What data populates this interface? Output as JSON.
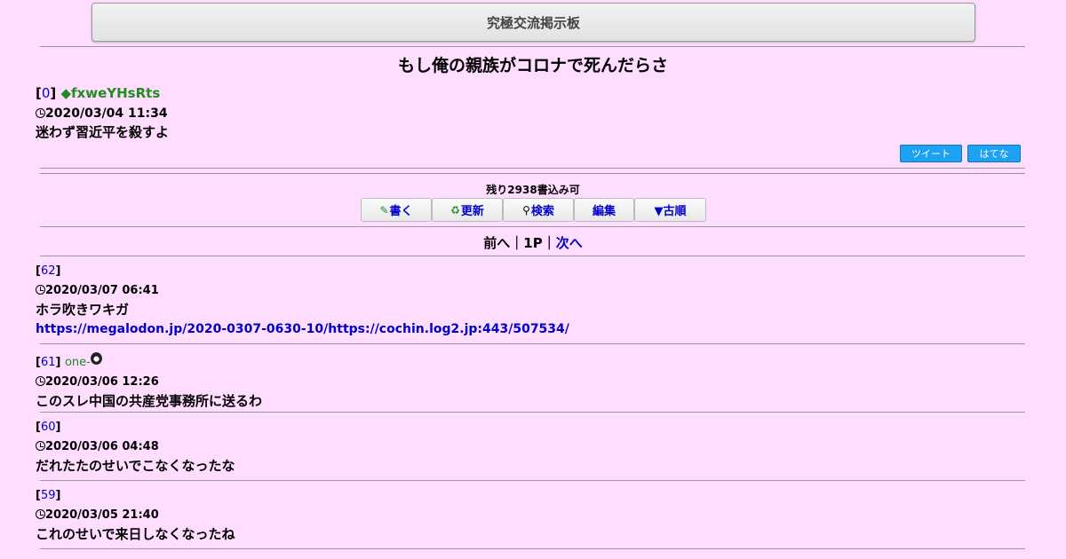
{
  "site": {
    "title": "究極交流掲示板"
  },
  "thread": {
    "title": "もし俺の親族がコロナで死んだらさ"
  },
  "op": {
    "num": "0",
    "name": "◆fxweYHsRts",
    "date": "2020/03/04 11:34",
    "body": "迷わず習近平を殺すよ"
  },
  "share": {
    "tweet_label": "ツイート",
    "hatena_label": "はてな"
  },
  "remaining": "残り2938書込み可",
  "toolbar": {
    "write_label": "書く",
    "refresh_label": "更新",
    "search_label": "検索",
    "edit_label": "編集",
    "order_label": "▼古順"
  },
  "pager": {
    "prev_label": "前へ",
    "sep": "｜",
    "current": "1P",
    "next_label": "次へ"
  },
  "posts": [
    {
      "num": "62",
      "name": "",
      "date": "2020/03/07 06:41",
      "body": "ホラ吹きワキガ",
      "link": "https://megalodon.jp/2020-0307-0630-10/https://cochin.log2.jp:443/507534/"
    },
    {
      "num": "61",
      "name": "one-",
      "date": "2020/03/06 12:26",
      "body": "このスレ中国の共産党事務所に送るわ"
    },
    {
      "num": "60",
      "name": "",
      "date": "2020/03/06 04:48",
      "body": "だれたたのせいでこなくなったな"
    },
    {
      "num": "59",
      "name": "",
      "date": "2020/03/05 21:40",
      "body": "これのせいで来日しなくなったね"
    }
  ]
}
